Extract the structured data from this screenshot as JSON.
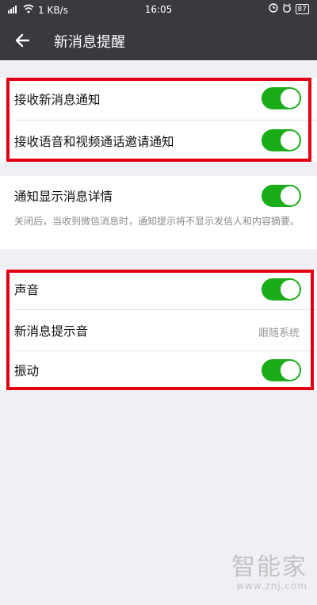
{
  "status_bar": {
    "net_speed": "1 KB/s",
    "time": "16:05",
    "battery": "87"
  },
  "header": {
    "title": "新消息提醒"
  },
  "group1": {
    "receive_new_message": {
      "label": "接收新消息通知",
      "on": true
    },
    "receive_voice_video": {
      "label": "接收语音和视频通话邀请通知",
      "on": true
    }
  },
  "group2": {
    "show_details": {
      "label": "通知显示消息详情",
      "on": true
    },
    "note": "关闭后，当收到微信消息时，通知提示将不显示发信人和内容摘要。"
  },
  "group3": {
    "sound": {
      "label": "声音",
      "on": true
    },
    "tone": {
      "label": "新消息提示音",
      "value": "跟随系统"
    },
    "vibrate": {
      "label": "振动",
      "on": true
    }
  },
  "colors": {
    "toggle_on": "#1aad19",
    "highlight_border": "#e30012",
    "header_bg": "#393a3f"
  },
  "watermark": {
    "text": "智能家",
    "url": "www.znj.com"
  }
}
